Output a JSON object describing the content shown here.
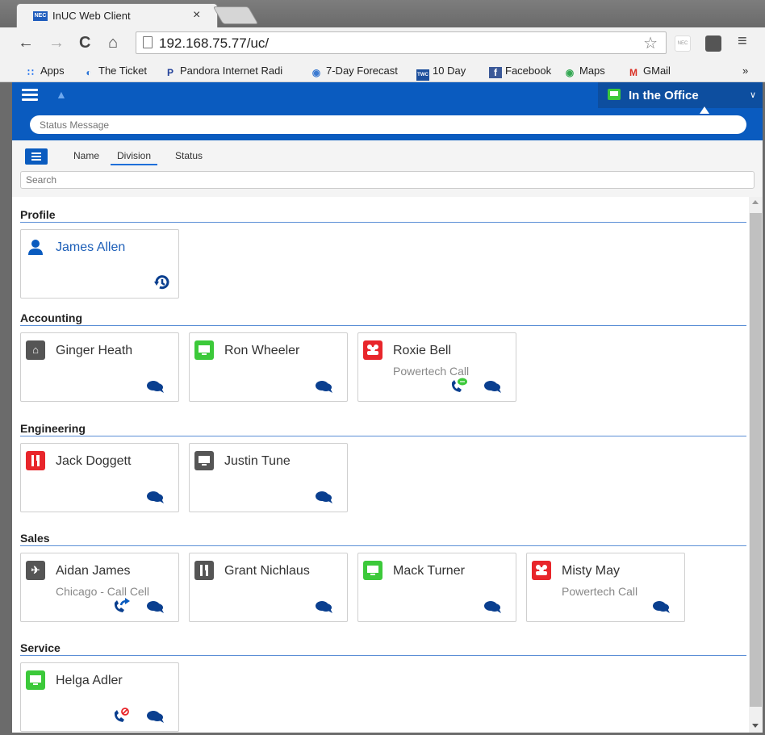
{
  "browser": {
    "tab_title": "InUC Web Client",
    "tab_favicon_text": "NEC",
    "tab_close": "×",
    "url": "192.168.75.77/uc/",
    "ext_label": "NEC",
    "bookmarks": [
      {
        "label": "Apps",
        "icon": "apps-icon"
      },
      {
        "label": "The Ticket",
        "icon": "ticket-icon"
      },
      {
        "label": "Pandora Internet Radi",
        "icon": "pandora-icon"
      },
      {
        "label": "7-Day Forecast",
        "icon": "forecast-icon"
      },
      {
        "label": "10 Day",
        "icon": "weather-channel-icon"
      },
      {
        "label": "Facebook",
        "icon": "facebook-icon"
      },
      {
        "label": "Maps",
        "icon": "maps-icon"
      },
      {
        "label": "GMail",
        "icon": "gmail-icon"
      }
    ],
    "more": "»"
  },
  "app": {
    "presence": "In the Office",
    "status_placeholder": "Status Message",
    "sort_tabs": [
      "Name",
      "Division",
      "Status"
    ],
    "search_placeholder": "Search",
    "accent": "#0a5bbf",
    "sections": [
      {
        "title": "Profile"
      },
      {
        "title": "Accounting"
      },
      {
        "title": "Engineering"
      },
      {
        "title": "Sales"
      },
      {
        "title": "Service"
      }
    ],
    "contacts": {
      "profile": {
        "name": "James Allen"
      },
      "ginger": {
        "name": "Ginger Heath",
        "status": "home"
      },
      "ron": {
        "name": "Ron Wheeler",
        "status": "in-office"
      },
      "roxie": {
        "name": "Roxie Bell",
        "status": "meeting",
        "sub": "Powertech Call"
      },
      "jack": {
        "name": "Jack Doggett",
        "status": "lunch"
      },
      "justin": {
        "name": "Justin Tune",
        "status": "offline"
      },
      "aidan": {
        "name": "Aidan James",
        "status": "travel",
        "sub": "Chicago - Call Cell"
      },
      "grant": {
        "name": "Grant Nichlaus",
        "status": "lunch-offline"
      },
      "mack": {
        "name": "Mack Turner",
        "status": "in-office"
      },
      "misty": {
        "name": "Misty May",
        "status": "meeting",
        "sub": "Powertech Call"
      },
      "helga": {
        "name": "Helga Adler",
        "status": "in-office"
      }
    },
    "status_colors": {
      "in-office": "#3cc93a",
      "meeting": "#e8262b",
      "away": "#555555",
      "blue": "#0a5bbf"
    }
  }
}
